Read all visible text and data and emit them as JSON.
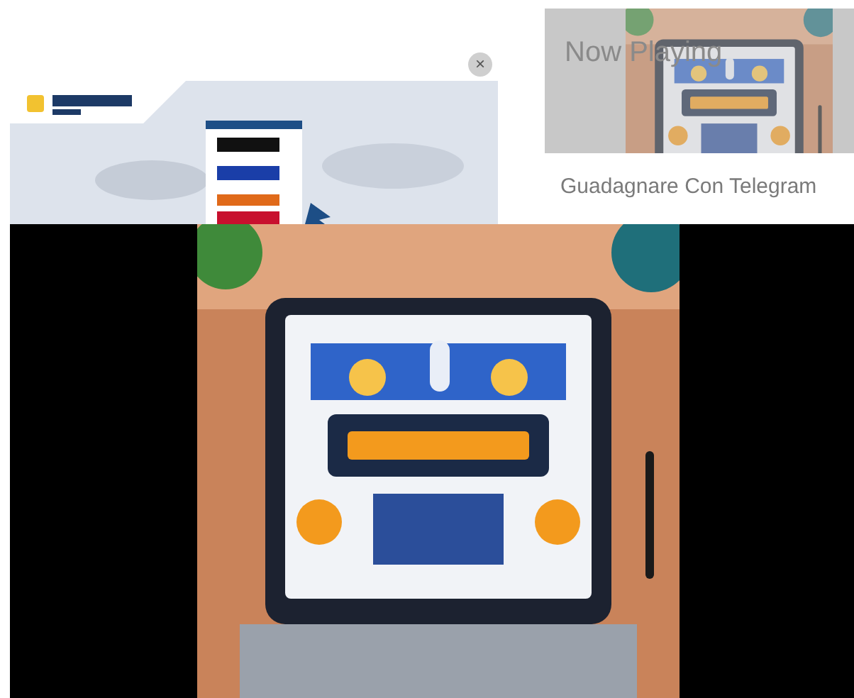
{
  "ad": {
    "kind": "picture",
    "close": "×"
  },
  "now_playing": {
    "label": "Now Playing",
    "title": "Guadagnare Con Telegram"
  }
}
